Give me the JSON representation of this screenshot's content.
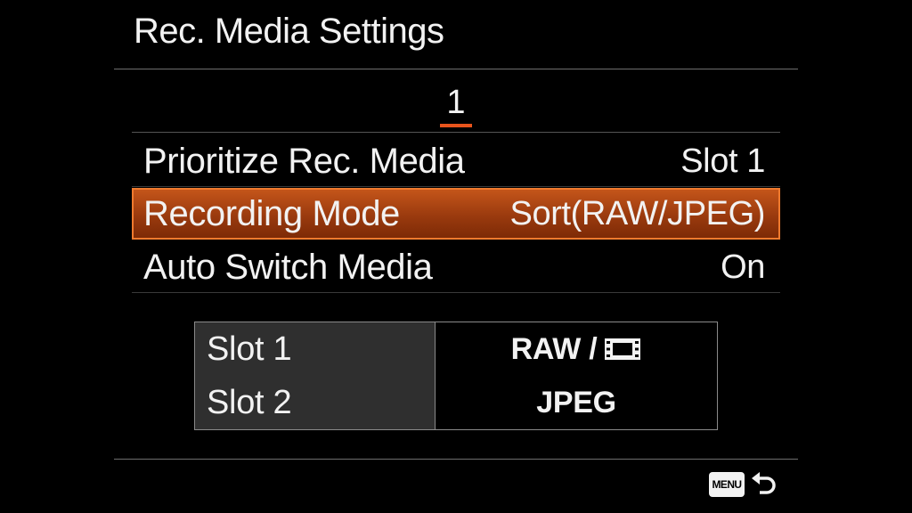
{
  "header": {
    "title": "Rec. Media Settings"
  },
  "tabs": {
    "current_page": "1"
  },
  "menu": {
    "items": [
      {
        "label": "Prioritize Rec. Media",
        "value": "Slot 1"
      },
      {
        "label": "Recording Mode",
        "value": "Sort(RAW/JPEG)",
        "selected": true
      },
      {
        "label": "Auto Switch Media",
        "value": "On"
      }
    ]
  },
  "slots": [
    {
      "name": "Slot 1",
      "format": "RAW /",
      "icon": "movie-film-icon"
    },
    {
      "name": "Slot 2",
      "format": "JPEG"
    }
  ],
  "footer": {
    "menu_badge": "MENU",
    "back_icon": "return-arrow-icon"
  },
  "colors": {
    "accent_orange": "#e8541c",
    "selected_row": "#b44a14",
    "selected_border": "#f07a2e"
  }
}
